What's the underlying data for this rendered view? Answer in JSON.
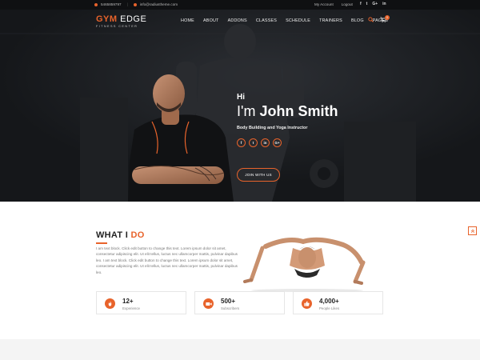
{
  "topbar": {
    "phone": "5465859797",
    "email": "info@radiustheme.com",
    "my_account": "My Account",
    "logout": "Logout",
    "social": [
      "f",
      "t",
      "G+",
      "in"
    ]
  },
  "brand": {
    "logo_part1": "GYM",
    "logo_part2": "EDGE",
    "tagline": "FITNESS CENTER"
  },
  "nav": {
    "items": [
      "HOME",
      "ABOUT",
      "ADDONS",
      "CLASSES",
      "SCHEDULE",
      "TRAINERS",
      "BLOG",
      "PAGES"
    ],
    "icons": [
      "search-icon",
      "cart-icon"
    ],
    "cart_count": "0"
  },
  "hero": {
    "greeting": "Hi",
    "name_prefix": "I'm",
    "name": "John Smith",
    "role": "Body Building and Yoga Instructor",
    "social": [
      "f",
      "t",
      "in",
      "G+"
    ],
    "cta": "JOIN WITH US"
  },
  "what_i_do": {
    "title_part1": "WHAT I",
    "title_part2": "DO",
    "paragraph": "I am text block. Click edit button to change this text. Lorem ipsum dolor sit amet, consectetur adipiscing elit. Ut elit tellus, luctus nec ullamcorper mattis, pulvinar dapibus leo. I am text block. Click edit button to change this text. Lorem ipsum dolor sit amet, consectetur adipiscing elit. Ut elit tellus, luctus nec ullamcorper mattis, pulvinar dapibus leo.",
    "stats": [
      {
        "value": "12+",
        "label": "Experience",
        "icon": "fire-icon"
      },
      {
        "value": "500+",
        "label": "Subscribers",
        "icon": "video-icon"
      },
      {
        "value": "4,000+",
        "label": "People Likes",
        "icon": "thumbs-up-icon"
      }
    ]
  },
  "colors": {
    "accent": "#e8632b",
    "dark": "#15171a"
  }
}
